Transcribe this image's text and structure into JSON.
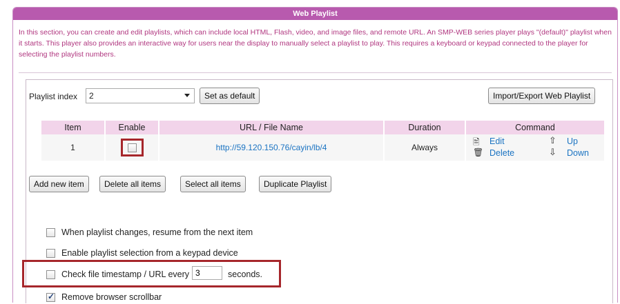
{
  "panel": {
    "title": "Web Playlist",
    "description": "In this section, you can create and edit playlists, which can include local HTML, Flash, video, and image files, and remote URL. An SMP-WEB series player plays \"(default)\" playlist when it starts. This player also provides an interactive way for users near the display to manually select a playlist to play. This requires a keyboard or keypad connected to the player for selecting the playlist numbers."
  },
  "controls": {
    "playlist_index_label": "Playlist index",
    "playlist_index_value": "2",
    "set_default_label": "Set as default",
    "import_export_label": "Import/Export Web Playlist"
  },
  "table": {
    "headers": [
      "Item",
      "Enable",
      "URL / File Name",
      "Duration",
      "Command"
    ],
    "rows": [
      {
        "item": "1",
        "enabled": false,
        "url": "http://59.120.150.76/cayin/lb/4",
        "duration": "Always",
        "cmd_edit": "Edit",
        "cmd_delete": "Delete",
        "cmd_up": "Up",
        "cmd_down": "Down"
      }
    ]
  },
  "actions": {
    "add_new": "Add new item",
    "delete_all": "Delete all items",
    "select_all": "Select all items",
    "duplicate": "Duplicate Playlist"
  },
  "options": {
    "resume_next": {
      "label": "When playlist changes, resume from the next item",
      "checked": false
    },
    "keypad_select": {
      "label": "Enable playlist selection from a keypad device",
      "checked": false
    },
    "check_timestamp": {
      "label_before": "Check file timestamp / URL every",
      "value": "3",
      "label_after": "seconds.",
      "checked": false
    },
    "remove_scrollbar": {
      "label": "Remove browser scrollbar",
      "checked": true
    }
  },
  "colors": {
    "header_bg": "#b85aae",
    "desc_text": "#b0367f",
    "table_header_bg": "#f2d4ea",
    "highlight_border": "#a6262b",
    "link": "#1a73c2"
  }
}
